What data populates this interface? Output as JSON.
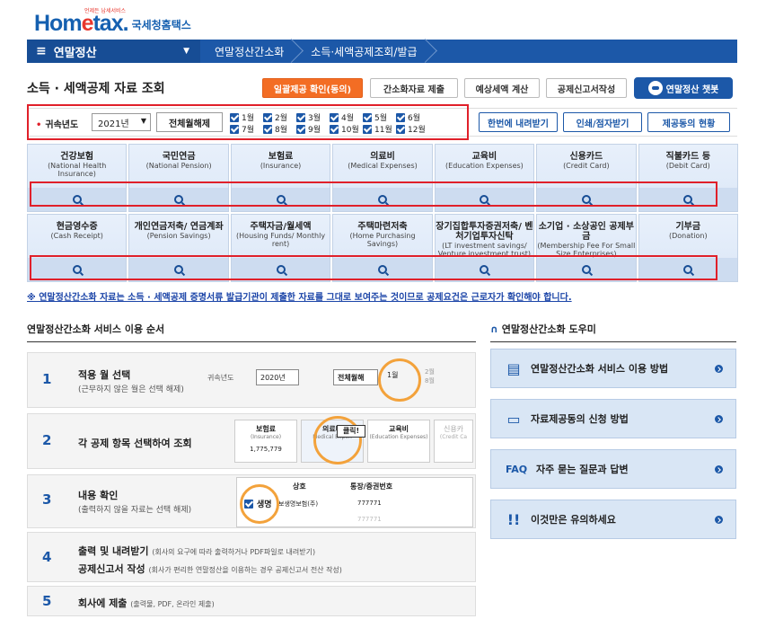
{
  "logo": {
    "brand_home": "Hom",
    "brand_e": "e",
    "brand_tax": "tax.",
    "kname": "국세청홈택스",
    "tagline": "언제든 납세서비스"
  },
  "nav": {
    "menu": "연말정산",
    "crumbs": [
      "연말정산간소화",
      "소득·세액공제조회/발급"
    ]
  },
  "title": "소득 · 세액공제 자료 조회",
  "buttons": {
    "consent": "일괄제공 확인(동의)",
    "simple_submit": "간소화자료 제출",
    "estimate": "예상세액 계산",
    "deduction_form": "공제신고서작성",
    "chatbot": "연말정산 챗봇",
    "download_all": "한번에 내려받기",
    "print": "인쇄/점자받기",
    "provider_status": "제공동의 현황"
  },
  "filter": {
    "year_label": "귀속년도",
    "year_value": "2021년",
    "clear_all": "전체월해제",
    "months": [
      "1월",
      "2월",
      "3월",
      "4월",
      "5월",
      "6월",
      "7월",
      "8월",
      "9월",
      "10월",
      "11월",
      "12월"
    ]
  },
  "row1": [
    {
      "name": "건강보험",
      "sub": "(National Health Insurance)"
    },
    {
      "name": "국민연금",
      "sub": "(National Pension)"
    },
    {
      "name": "보험료",
      "sub": "(Insurance)"
    },
    {
      "name": "의료비",
      "sub": "(Medical Expenses)"
    },
    {
      "name": "교육비",
      "sub": "(Education Expenses)"
    },
    {
      "name": "신용카드",
      "sub": "(Credit Card)"
    },
    {
      "name": "직불카드 등",
      "sub": "(Debit Card)"
    }
  ],
  "row2": [
    {
      "name": "현금영수증",
      "sub": "(Cash Receipt)"
    },
    {
      "name": "개인연금저축/ 연금계좌",
      "sub": "(Pension Savings)"
    },
    {
      "name": "주택자금/월세액",
      "sub": "(Housing Funds/ Monthly rent)"
    },
    {
      "name": "주택마련저축",
      "sub": "(Home Purchasing Savings)"
    },
    {
      "name": "장기집합투자증권저축/ 벤처기업투자신탁",
      "sub": "(LT investment savings/ Venture investment trust)"
    },
    {
      "name": "소기업 · 소상공인 공제부금",
      "sub": "(Membership Fee For Small Size Enterprises)"
    },
    {
      "name": "기부금",
      "sub": "(Donation)"
    }
  ],
  "notice": "※ 연말정산간소화 자료는 소득 · 세액공제 증명서류 발급기관이 제출한 자료를 그대로 보여주는 것이므로 공제요건은 근로자가 확인해야 합니다.",
  "steps_title": "연말정산간소화 서비스 이용 순서",
  "steps": [
    {
      "num": "1",
      "text": "적용 월 선택",
      "sub": "(근무하지 않은 월은 선택 해제)"
    },
    {
      "num": "2",
      "text": "각 공제 항목 선택하여 조회",
      "sub": ""
    },
    {
      "num": "3",
      "text": "내용 확인",
      "sub": "(출력하지 않을 자료는 선택 해제)"
    },
    {
      "num": "4",
      "text": "출력 및 내려받기",
      "sub": "(회사의 요구에 따라 출력하거나 PDF파일로 내려받기)",
      "text2": "공제신고서 작성",
      "sub2": "(회사가 편리한 연말정산을 이용하는 경우 공제신고서 전산 작성)"
    },
    {
      "num": "5",
      "text": "회사에 제출",
      "sub": "(출력물, PDF, 온라인 제출)"
    }
  ],
  "step_previews": {
    "s1_label": "귀속년도",
    "s1_year": "2020년",
    "s1_clear": "전체월해",
    "s1_m1": "1월",
    "s1_m2": "2월",
    "s1_m3": "8월",
    "s2_c1": "보험료",
    "s2_c1s": "(Insurance)",
    "s2_c2": "의료비",
    "s2_c2s": "Medical Expen",
    "s2_c3": "교육비",
    "s2_c3s": "(Education Expenses)",
    "s2_c4": "신용카",
    "s2_c4s": "(Credit Ca",
    "s2_amount": "1,775,779",
    "s2_click": "클릭!",
    "s3_h1": "상호",
    "s3_h2": "통장/증권번호",
    "s3_r1": "생명보험(주)",
    "s3_r1n": "777771",
    "s3_r2": "생명",
    "s3_r2full": "보생명보험(주)",
    "s3_r2n": "777771"
  },
  "help_title": "연말정산간소화 도우미",
  "help": [
    {
      "icon": "manual-icon",
      "label": "연말정산간소화 서비스 이용 방법"
    },
    {
      "icon": "document-icon",
      "label": "자료제공동의 신청 방법"
    },
    {
      "icon": "faq-icon",
      "iconText": "FAQ",
      "label": "자주 묻는 질문과 답변"
    },
    {
      "icon": "warning-icon",
      "label": "이것만은 유의하세요"
    }
  ]
}
